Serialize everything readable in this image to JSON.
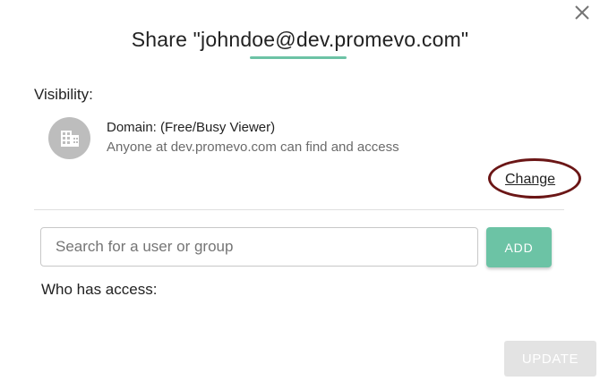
{
  "dialog": {
    "title": "Share \"johndoe@dev.promevo.com\"",
    "accent_color": "#6cc3a5",
    "close_icon": "close-icon"
  },
  "visibility": {
    "label": "Visibility:",
    "icon": "building-icon",
    "domain_title": "Domain: (Free/Busy Viewer)",
    "domain_description": "Anyone at dev.promevo.com can find and access",
    "change_label": "Change",
    "highlight_color": "#6b1616"
  },
  "search": {
    "placeholder": "Search for a user or group",
    "value": "",
    "add_label": "ADD"
  },
  "access": {
    "label": "Who has access:"
  },
  "footer": {
    "update_label": "UPDATE",
    "update_disabled": true
  }
}
